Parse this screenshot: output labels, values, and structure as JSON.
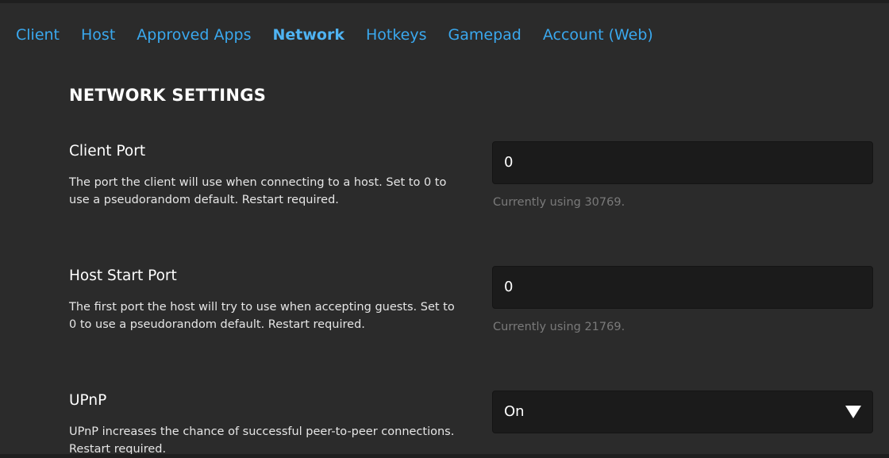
{
  "tabs": [
    {
      "label": "Client"
    },
    {
      "label": "Host"
    },
    {
      "label": "Approved Apps"
    },
    {
      "label": "Network",
      "active": true
    },
    {
      "label": "Hotkeys"
    },
    {
      "label": "Gamepad"
    },
    {
      "label": "Account (Web)"
    }
  ],
  "section": {
    "title": "NETWORK SETTINGS"
  },
  "settings": {
    "client_port": {
      "label": "Client Port",
      "description_line1": "The port the client will use when connecting to a host. Set to 0 to",
      "description_line2": "use a pseudorandom default. Restart required.",
      "value": "0",
      "hint": "Currently using 30769."
    },
    "host_start_port": {
      "label": "Host Start Port",
      "description_line1": "The first port the host will try to use when accepting guests. Set to",
      "description_line2": "0 to use a pseudorandom default. Restart required.",
      "value": "0",
      "hint": "Currently using 21769."
    },
    "upnp": {
      "label": "UPnP",
      "description_line1": "UPnP increases the chance of successful peer-to-peer connections.",
      "description_line2": "Restart required.",
      "selected": "On"
    }
  },
  "colors": {
    "background": "#2b2b2b",
    "tab_link": "#3aa8ee",
    "field_bg": "#1b1b1b",
    "hint": "#7a7a7a"
  },
  "icons": {
    "dropdown": "triangle-down-icon"
  }
}
